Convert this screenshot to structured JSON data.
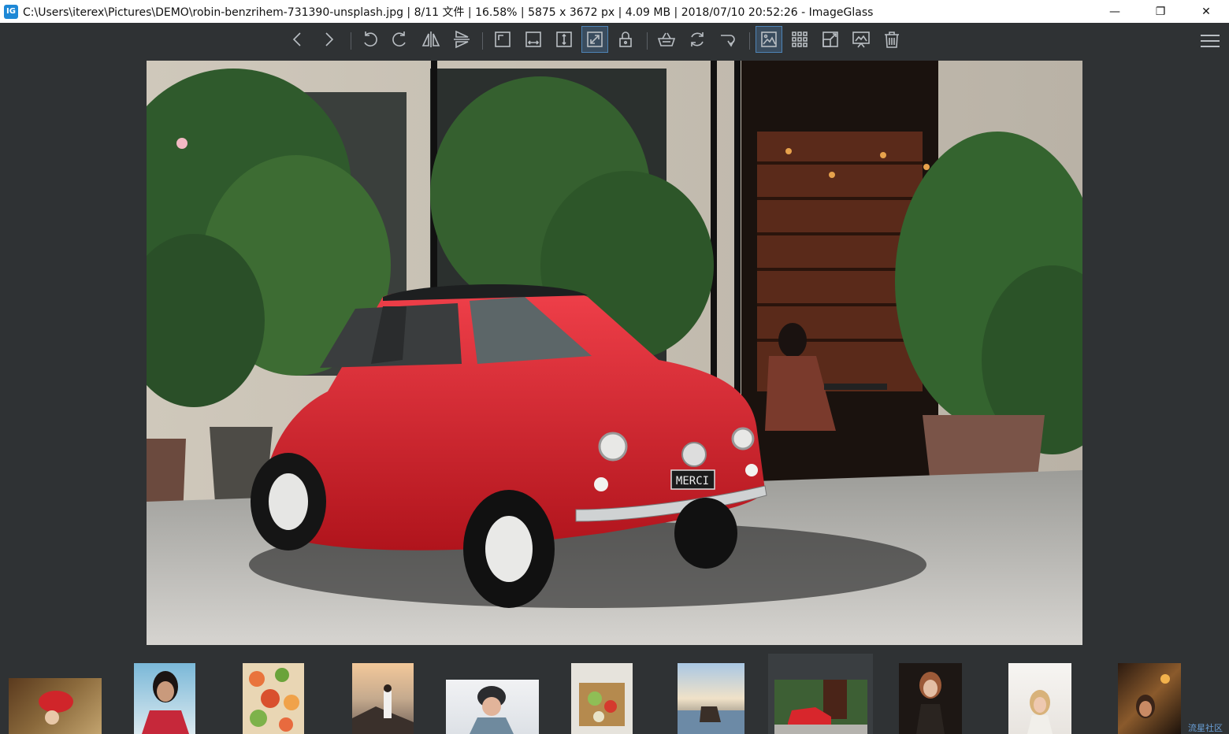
{
  "window": {
    "title": "C:\\Users\\iterex\\Pictures\\DEMO\\robin-benzrihem-731390-unsplash.jpg  |  8/11 文件  |  16.58%  |  5875 x 3672 px  |  4.09 MB  |  2018/07/10 20:52:26  - ImageGlass",
    "app_icon_text": "IG",
    "minimize": "—",
    "restore": "❐",
    "close": "✕"
  },
  "toolbar": {
    "buttons": [
      "previous",
      "next",
      "rotate-left",
      "rotate-right",
      "flip-horizontal",
      "flip-vertical",
      "actual-size",
      "fit-width",
      "fit-height",
      "auto-zoom",
      "lock-zoom",
      "scale-to-fill",
      "refresh",
      "goto",
      "checkerboard",
      "thumbnail-bar",
      "fullscreen",
      "slideshow",
      "delete",
      "menu"
    ],
    "active": [
      "auto-zoom",
      "checkerboard"
    ]
  },
  "colors": {
    "background": "#2f3234",
    "accent": "#4e84b6",
    "car": "#d8262c"
  },
  "thumbnails": {
    "count": 11,
    "selected_index": 7
  },
  "watermark": "流星社区"
}
